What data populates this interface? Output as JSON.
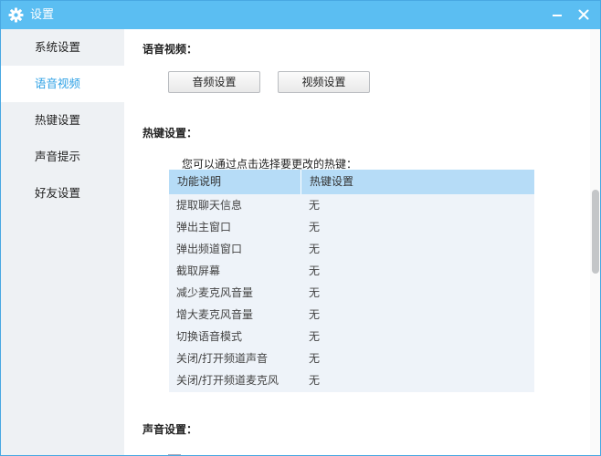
{
  "window": {
    "title": "设置",
    "icon": "gear-icon",
    "accent_color": "#5bbef2",
    "active_color": "#2ea1e5"
  },
  "sidebar": {
    "items": [
      {
        "label": "系统设置"
      },
      {
        "label": "语音视频",
        "active": true
      },
      {
        "label": "热键设置"
      },
      {
        "label": "声音提示"
      },
      {
        "label": "好友设置"
      }
    ]
  },
  "voice_video": {
    "title": "语音视频：",
    "audio_button": "音频设置",
    "video_button": "视频设置"
  },
  "hotkeys": {
    "title": "热键设置：",
    "hint": "您可以通过点击选择要更改的热键：",
    "columns": [
      "功能说明",
      "热键设置"
    ],
    "rows": [
      {
        "name": "提取聊天信息",
        "key": "无"
      },
      {
        "name": "弹出主窗口",
        "key": "无"
      },
      {
        "name": "弹出频道窗口",
        "key": "无"
      },
      {
        "name": "截取屏幕",
        "key": "无"
      },
      {
        "name": "减少麦克风音量",
        "key": "无"
      },
      {
        "name": "增大麦克风音量",
        "key": "无"
      },
      {
        "name": "切换语音模式",
        "key": "无"
      },
      {
        "name": "关闭/打开频道声音",
        "key": "无"
      },
      {
        "name": "关闭/打开频道麦克风",
        "key": "无"
      }
    ]
  },
  "sound": {
    "title": "声音设置："
  }
}
